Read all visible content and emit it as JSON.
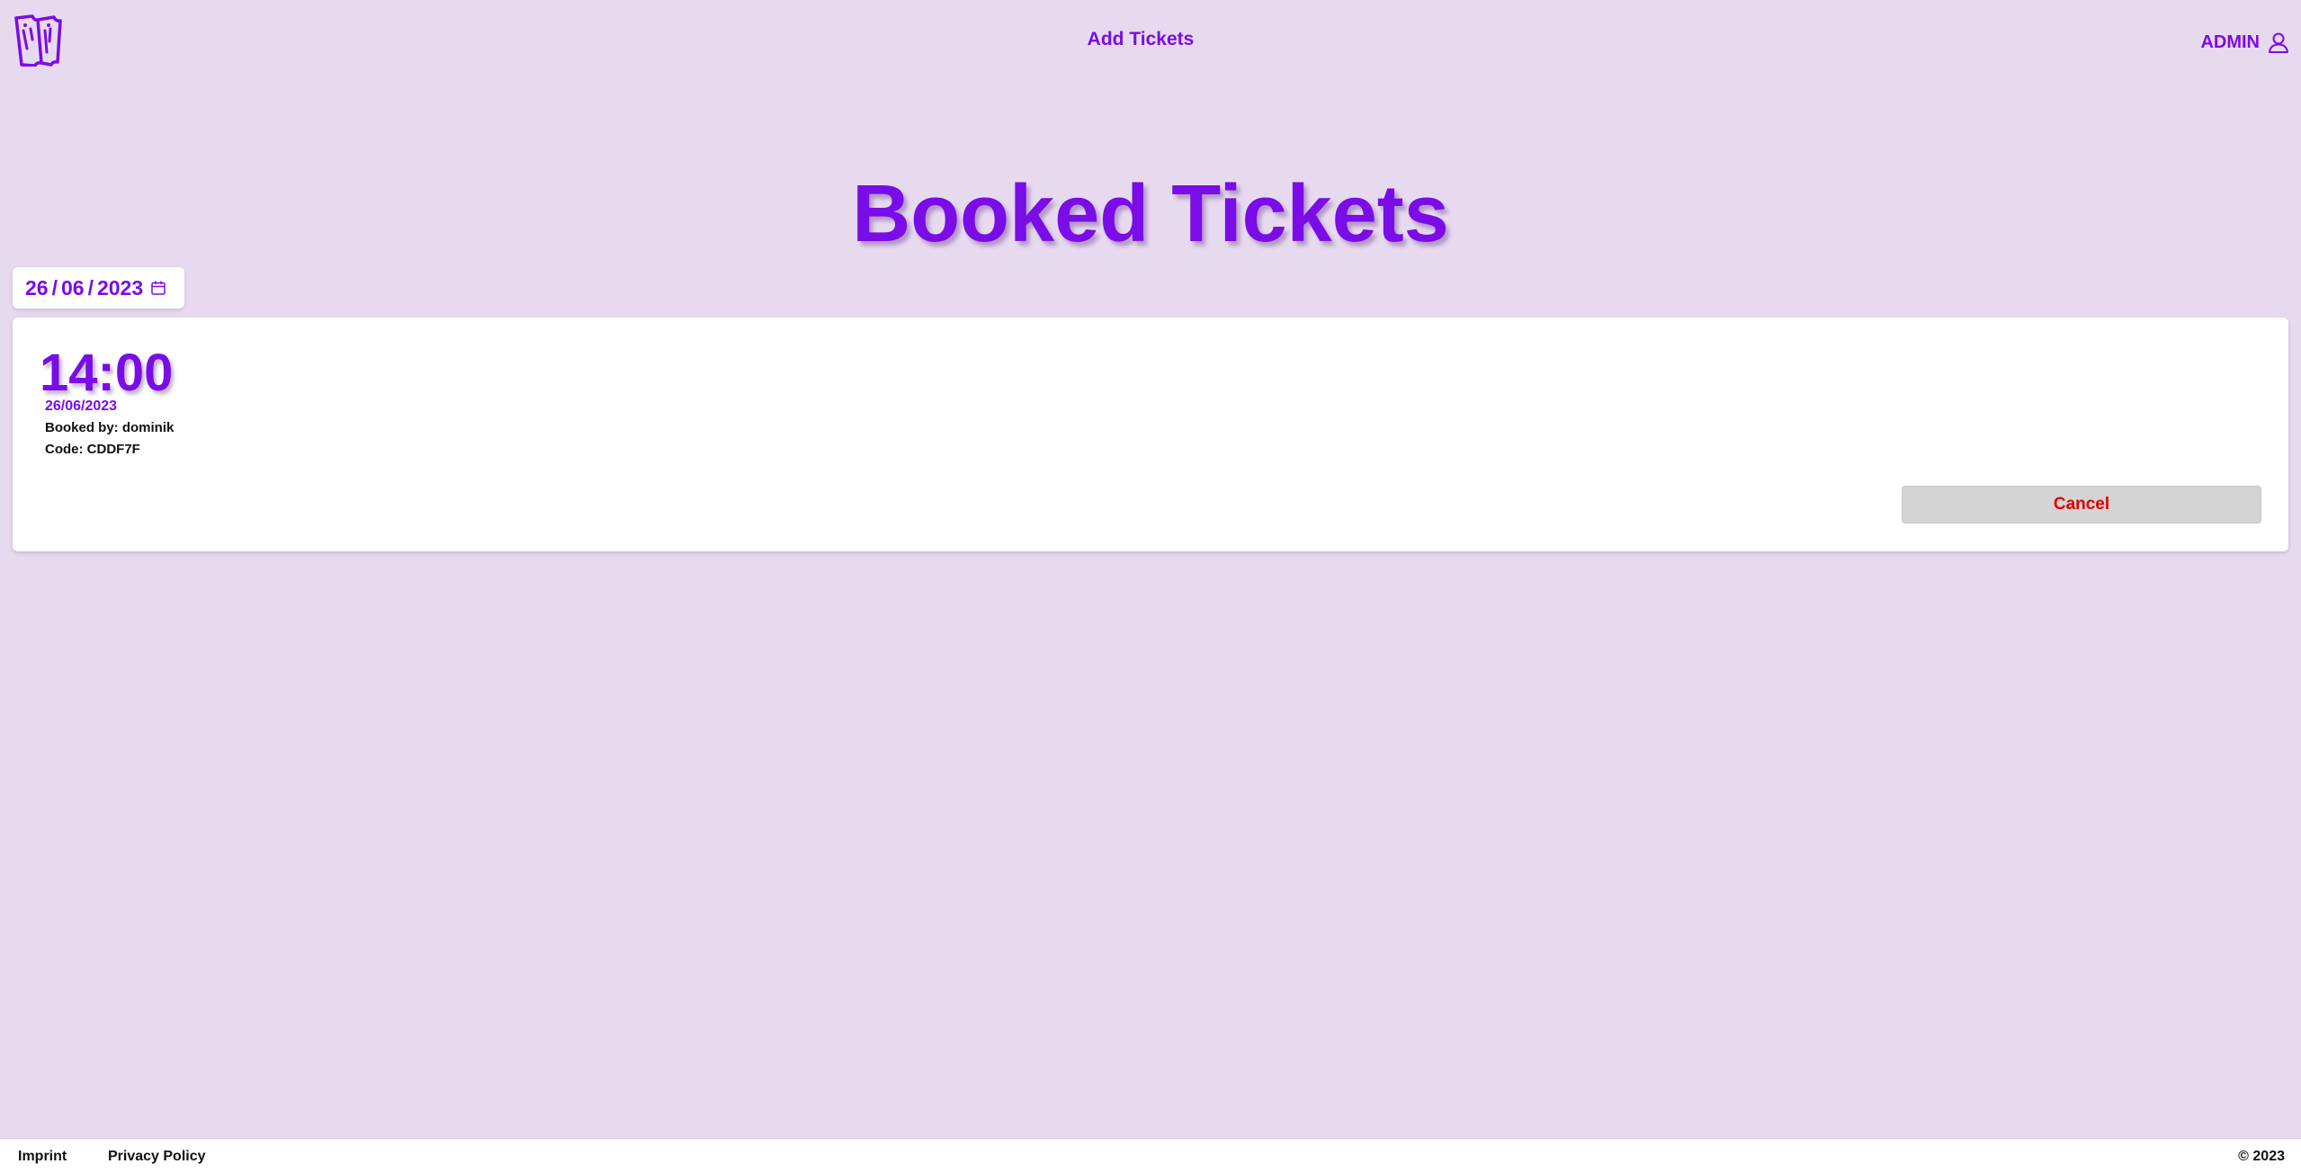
{
  "header": {
    "logo_icon": "ticket-logo-icon",
    "nav_link": "Add Tickets",
    "user_label": "ADMIN",
    "user_icon": "user-icon"
  },
  "page_title": "Booked Tickets",
  "date_filter": {
    "day": "26",
    "month": "06",
    "year": "2023",
    "separator": "/",
    "icon": "calendar-icon"
  },
  "tickets": [
    {
      "time": "14:00",
      "date": "26/06/2023",
      "booked_by": "Booked by: dominik",
      "code": "Code: CDDF7F",
      "cancel_label": "Cancel"
    }
  ],
  "footer": {
    "imprint": "Imprint",
    "privacy": "Privacy Policy",
    "copyright": "© 2023"
  },
  "colors": {
    "background": "#e8daee",
    "accent": "#7a0ce8",
    "danger": "#e00000",
    "card": "#ffffff"
  }
}
